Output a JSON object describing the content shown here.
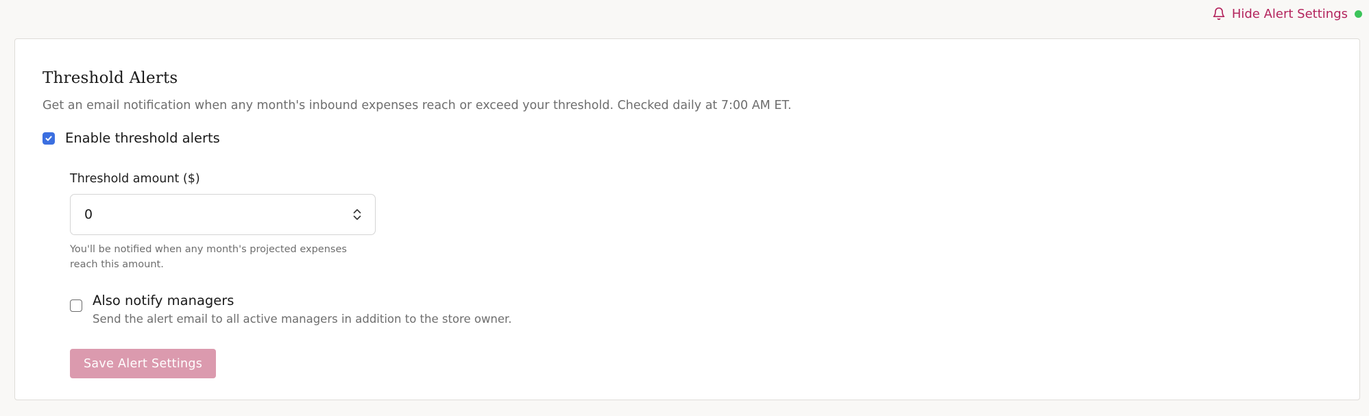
{
  "header": {
    "toggle_label": "Hide Alert Settings",
    "toggle_icon": "bell-icon",
    "status_color": "#3cc45a",
    "accent_color": "#b3235c"
  },
  "section": {
    "title": "Threshold Alerts",
    "description": "Get an email notification when any month's inbound expenses reach or exceed your threshold. Checked daily at 7:00 AM ET."
  },
  "enable": {
    "label": "Enable threshold alerts",
    "checked": true
  },
  "threshold": {
    "label": "Threshold amount ($)",
    "value": "0",
    "hint": "You'll be notified when any month's projected expenses reach this amount."
  },
  "managers": {
    "label": "Also notify managers",
    "description": "Send the alert email to all active managers in addition to the store owner.",
    "checked": false
  },
  "actions": {
    "save_label": "Save Alert Settings",
    "save_color": "#db9aae"
  }
}
